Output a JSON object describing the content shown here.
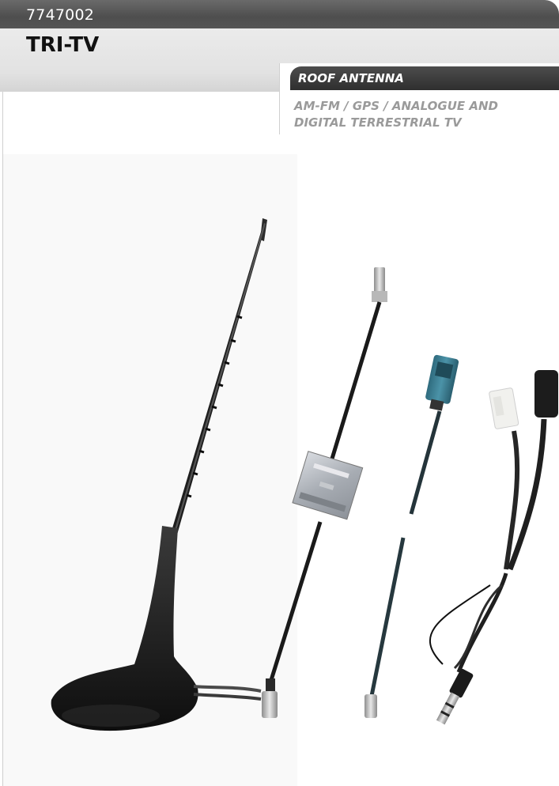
{
  "header": {
    "code": "7747002",
    "title": "TRI-TV"
  },
  "category": {
    "label": "ROOF ANTENNA",
    "subtitle_line1": "AM-FM / GPS / ANALOGUE AND",
    "subtitle_line2": "DIGITAL TERRESTRIAL TV"
  },
  "colors": {
    "header_dark": "#555555",
    "title_band": "#e6e6e6",
    "category_bar": "#3a3a3a",
    "subtitle_text": "#9a9a9a",
    "connector_blue": "#3e7f93"
  }
}
